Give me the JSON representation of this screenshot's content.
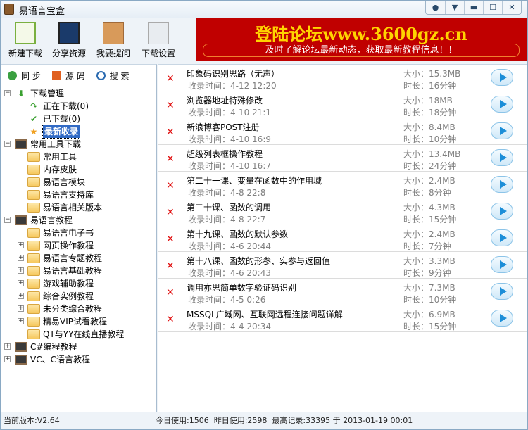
{
  "title": "易语言宝盒",
  "toolbar": [
    {
      "label": "新建下载",
      "icon": "new-download-icon"
    },
    {
      "label": "分享资源",
      "icon": "share-icon"
    },
    {
      "label": "我要提问",
      "icon": "question-icon"
    },
    {
      "label": "下载设置",
      "icon": "settings-icon"
    }
  ],
  "banner": {
    "headline": "登陆论坛www.3600gz.cn",
    "subline": "及时了解论坛最新动态，获取最新教程信息！！"
  },
  "tabs": [
    {
      "label": "同 步"
    },
    {
      "label": "源 码"
    },
    {
      "label": "搜 索"
    }
  ],
  "tree": [
    {
      "label": "下载管理",
      "level": 0,
      "exp": "−",
      "icon": "down-arrow-icon"
    },
    {
      "label": "正在下载(0)",
      "level": 1,
      "icon": "refresh-arrow-icon"
    },
    {
      "label": "已下载(0)",
      "level": 1,
      "icon": "check-icon"
    },
    {
      "label": "最新收录",
      "level": 1,
      "icon": "star-icon",
      "selected": true
    },
    {
      "label": "常用工具下载",
      "level": 0,
      "exp": "−",
      "icon": "board-icon"
    },
    {
      "label": "常用工具",
      "level": 1,
      "icon": "folder-icon"
    },
    {
      "label": "内存皮肤",
      "level": 1,
      "icon": "folder-icon"
    },
    {
      "label": "易语言模块",
      "level": 1,
      "icon": "folder-icon"
    },
    {
      "label": "易语言支持库",
      "level": 1,
      "icon": "folder-icon"
    },
    {
      "label": "易语言相关版本",
      "level": 1,
      "icon": "folder-icon"
    },
    {
      "label": "易语言教程",
      "level": 0,
      "exp": "−",
      "icon": "board-icon"
    },
    {
      "label": "易语言电子书",
      "level": 1,
      "icon": "folder-icon"
    },
    {
      "label": "网页操作教程",
      "level": 1,
      "exp": "+",
      "icon": "folder-icon"
    },
    {
      "label": "易语言专题教程",
      "level": 1,
      "exp": "+",
      "icon": "folder-icon"
    },
    {
      "label": "易语言基础教程",
      "level": 1,
      "exp": "+",
      "icon": "folder-icon"
    },
    {
      "label": "游戏辅助教程",
      "level": 1,
      "exp": "+",
      "icon": "folder-icon"
    },
    {
      "label": "综合实例教程",
      "level": 1,
      "exp": "+",
      "icon": "folder-icon"
    },
    {
      "label": "未分类综合教程",
      "level": 1,
      "exp": "+",
      "icon": "folder-icon"
    },
    {
      "label": "精易VIP试看教程",
      "level": 1,
      "exp": "+",
      "icon": "folder-icon"
    },
    {
      "label": "QT与YY在线直播教程",
      "level": 1,
      "icon": "folder-icon"
    },
    {
      "label": "C#编程教程",
      "level": 0,
      "exp": "+",
      "icon": "board-icon"
    },
    {
      "label": "VC、C语言教程",
      "level": 0,
      "exp": "+",
      "icon": "board-icon"
    }
  ],
  "items": [
    {
      "title": "印象码识别思路（无声）",
      "time": "收录时间：4-12 12:20",
      "size": "大小：15.3MB",
      "duration": "时长：16分钟"
    },
    {
      "title": "浏览器地址特殊修改",
      "time": "收录时间：4-10 21:1",
      "size": "大小：18MB",
      "duration": "时长：18分钟"
    },
    {
      "title": "新浪博客POST注册",
      "time": "收录时间：4-10 16:9",
      "size": "大小：8.4MB",
      "duration": "时长：10分钟"
    },
    {
      "title": "超级列表框操作教程",
      "time": "收录时间：4-10 16:7",
      "size": "大小：13.4MB",
      "duration": "时长：24分钟"
    },
    {
      "title": "第二十一课、变量在函数中的作用域",
      "time": "收录时间：4-8 22:8",
      "size": "大小：2.4MB",
      "duration": "时长：8分钟"
    },
    {
      "title": "第二十课、函数的调用",
      "time": "收录时间：4-8 22:7",
      "size": "大小：4.3MB",
      "duration": "时长：15分钟"
    },
    {
      "title": "第十九课、函数的默认参数",
      "time": "收录时间：4-6 20:44",
      "size": "大小：2.4MB",
      "duration": "时长：7分钟"
    },
    {
      "title": "第十八课、函数的形参、实参与返回值",
      "time": "收录时间：4-6 20:43",
      "size": "大小：3.3MB",
      "duration": "时长：9分钟"
    },
    {
      "title": "调用亦思简单数字验证码识别",
      "time": "收录时间：4-5 0:26",
      "size": "大小：7.3MB",
      "duration": "时长：10分钟"
    },
    {
      "title": "MSSQL广域网、互联网远程连接问题详解",
      "time": "收录时间：4-4 20:34",
      "size": "大小：6.9MB",
      "duration": "时长：15分钟"
    }
  ],
  "status": {
    "version": "当前版本:V2.64",
    "stats": "今日使用:1506  昨日使用:2598  最高记录:33395 于 2013-01-19 00:01"
  }
}
